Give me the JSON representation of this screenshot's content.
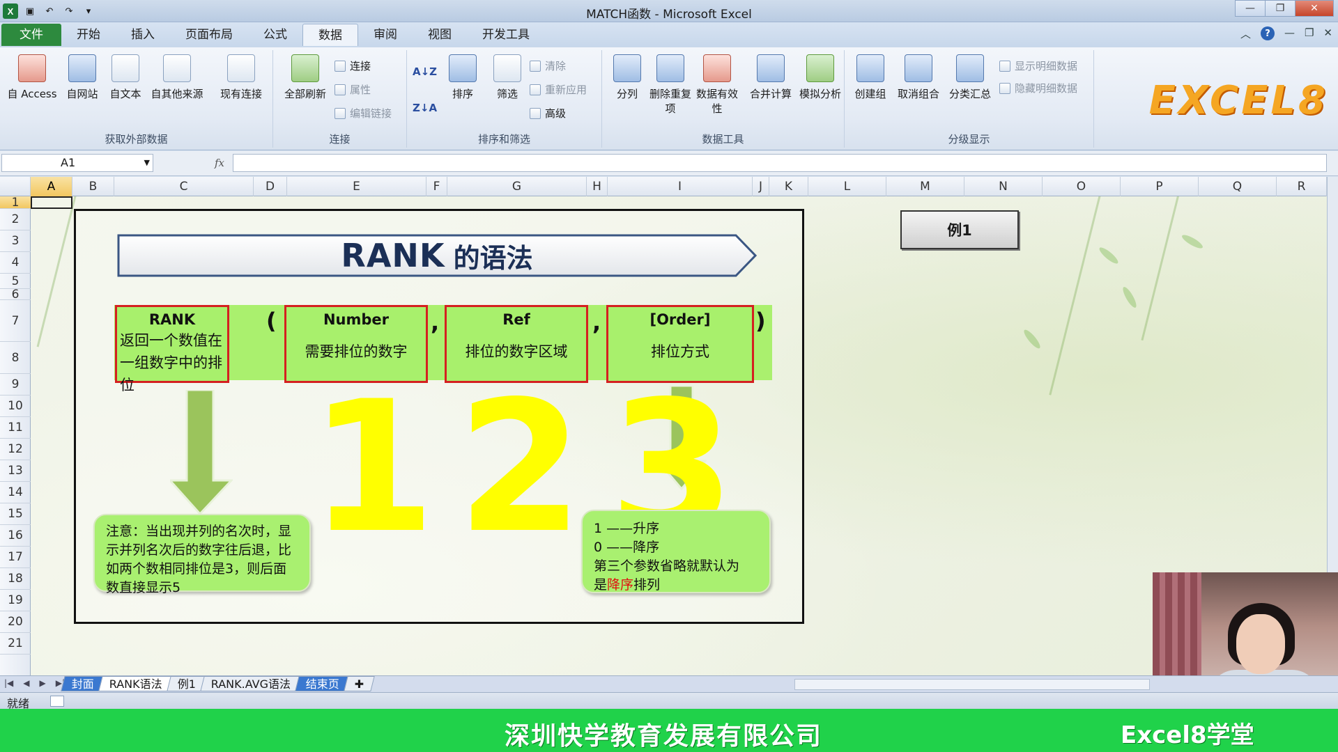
{
  "window": {
    "title": "MATCH函数 - Microsoft Excel",
    "min": "—",
    "restore": "❐",
    "close": "✕"
  },
  "ribbon_tabs": [
    "文件",
    "开始",
    "插入",
    "页面布局",
    "公式",
    "数据",
    "审阅",
    "视图",
    "开发工具"
  ],
  "active_tab": "数据",
  "ribbon": {
    "get_external": {
      "label": "获取外部数据",
      "buttons": [
        "自 Access",
        "自网站",
        "自文本",
        "自其他来源",
        "现有连接"
      ]
    },
    "connections": {
      "label": "连接",
      "refresh_all": "全部刷新",
      "items": [
        "连接",
        "属性",
        "编辑链接"
      ]
    },
    "sort_filter": {
      "label": "排序和筛选",
      "sort": "排序",
      "filter": "筛选",
      "items": [
        "清除",
        "重新应用",
        "高级"
      ]
    },
    "data_tools": {
      "label": "数据工具",
      "buttons": [
        "分列",
        "删除重复项",
        "数据有效性",
        "合并计算",
        "模拟分析"
      ]
    },
    "outline": {
      "label": "分级显示",
      "buttons": [
        "创建组",
        "取消组合",
        "分类汇总"
      ],
      "items": [
        "显示明细数据",
        "隐藏明细数据"
      ]
    },
    "logo": "EXCEL8"
  },
  "formula_bar": {
    "name_box": "A1",
    "fx": "fx",
    "value": ""
  },
  "columns": [
    "A",
    "B",
    "C",
    "D",
    "E",
    "F",
    "G",
    "H",
    "I",
    "J",
    "K",
    "L",
    "M",
    "N",
    "O",
    "P",
    "Q",
    "R"
  ],
  "rows": [
    "1",
    "2",
    "3",
    "4",
    "5",
    "6",
    "7",
    "8",
    "9",
    "10",
    "11",
    "12",
    "13",
    "14",
    "15",
    "16",
    "17",
    "18",
    "19",
    "20",
    "21"
  ],
  "selected_cell": "A1",
  "slide": {
    "banner_main": "RANK",
    "banner_sub": "的语法",
    "boxes": [
      {
        "title": "RANK",
        "desc": "返回一个数值在一组数字中的排位"
      },
      {
        "title": "Number",
        "desc": "需要排位的数字"
      },
      {
        "title": "Ref",
        "desc": "排位的数字区域"
      },
      {
        "title": "[Order]",
        "desc": "排位方式"
      }
    ],
    "paren_open": "(",
    "comma": ",",
    "paren_close": ")",
    "numbers": [
      "1",
      "2",
      "3"
    ],
    "note_left": "注意：当出现并列的名次时，显示并列名次后的数字往后退，比如两个数相同排位是3，则后面数直接显示5",
    "note_right": {
      "line1": "1 ——升序",
      "line2": "0 ——降序",
      "line3": "第三个参数省略就默认为",
      "line4_pre": "是",
      "line4_red": "降序",
      "line4_post": "排列"
    }
  },
  "example_button": "例1",
  "sheet_tabs": [
    "封面",
    "RANK语法",
    "例1",
    "RANK.AVG语法",
    "结束页"
  ],
  "active_sheet": "RANK语法",
  "status": "就绪",
  "footer": {
    "company": "深圳快学教育发展有限公司",
    "brand": "Excel8学堂"
  },
  "colors": {
    "green_box": "#a8f06c",
    "red_border": "#d42020",
    "yellow": "#ffff00",
    "footer_green": "#20d24a"
  }
}
